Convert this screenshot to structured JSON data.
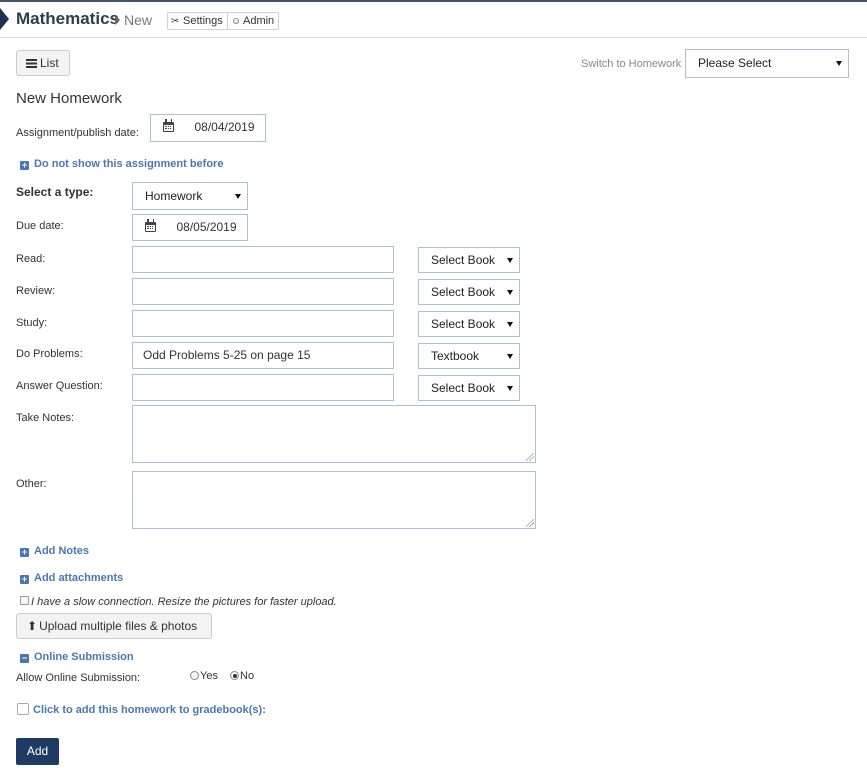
{
  "header": {
    "title": "Mathematics",
    "sub": "New",
    "settings_label": "Settings",
    "admin_label": "Admin"
  },
  "toolbar": {
    "list_label": "List",
    "switch_label": "Switch to Homework",
    "switch_value": "Please Select"
  },
  "form": {
    "title": "New Homework",
    "publish_label": "Assignment/publish date:",
    "publish_date": "08/04/2019",
    "hide_before_link": "Do not show this assignment before",
    "type_label": "Select a type:",
    "type_value": "Homework",
    "due_label": "Due date:",
    "due_date": "08/05/2019",
    "rows": [
      {
        "label": "Read:",
        "value": "",
        "book": "Select Book"
      },
      {
        "label": "Review:",
        "value": "",
        "book": "Select Book"
      },
      {
        "label": "Study:",
        "value": "",
        "book": "Select Book"
      },
      {
        "label": "Do Problems:",
        "value": "Odd Problems 5-25 on page 15",
        "book": "Textbook"
      },
      {
        "label": "Answer Question:",
        "value": "",
        "book": "Select Book"
      }
    ],
    "take_notes_label": "Take Notes:",
    "other_label": "Other:",
    "add_notes_link": "Add Notes",
    "add_attachments_link": "Add attachments",
    "slow_connection_label": "I have a slow connection. Resize the pictures for faster upload.",
    "upload_label": "Upload multiple files & photos",
    "online_submission_link": "Online Submission",
    "allow_online_label": "Allow Online Submission:",
    "yes_label": "Yes",
    "no_label": "No",
    "gradebook_link": "Click to add this homework to gradebook(s):",
    "add_label": "Add"
  }
}
